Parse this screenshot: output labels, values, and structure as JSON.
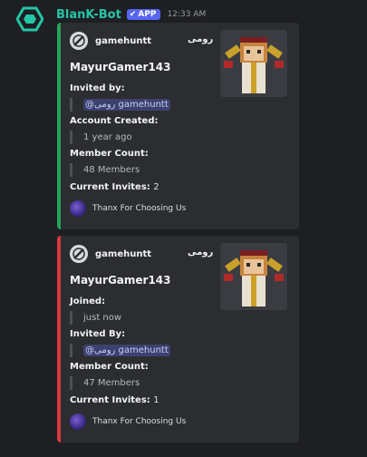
{
  "bot": {
    "name": "BlanK-Bot",
    "badge": "APP",
    "time": "12:33 AM",
    "accent": "#23c6a6"
  },
  "embeds": [
    {
      "color": "#23a55a",
      "author_name": "gamehuntt",
      "author_arabic": "رومی",
      "title": "MayurGamer143",
      "field1_name": "Invited by:",
      "field1_mention": "@رومی gamehuntt",
      "field2_name": "Account Created:",
      "field2_value": "1 year ago",
      "field3_name": "Member Count:",
      "field3_value": "48 Members",
      "field4_name": "Current Invites:",
      "field4_value": "2",
      "footer": "Thanx For Choosing Us"
    },
    {
      "color": "#da373c",
      "author_name": "gamehuntt",
      "author_arabic": "رومی",
      "title": "MayurGamer143",
      "field1_name": "Joined:",
      "field1_value": "just now",
      "field2_name": "Invited By:",
      "field2_mention": "@رومی gamehuntt",
      "field3_name": "Member Count:",
      "field3_value": "47 Members",
      "field4_name": "Current Invites:",
      "field4_value": "1",
      "footer": "Thanx For Choosing Us"
    }
  ]
}
